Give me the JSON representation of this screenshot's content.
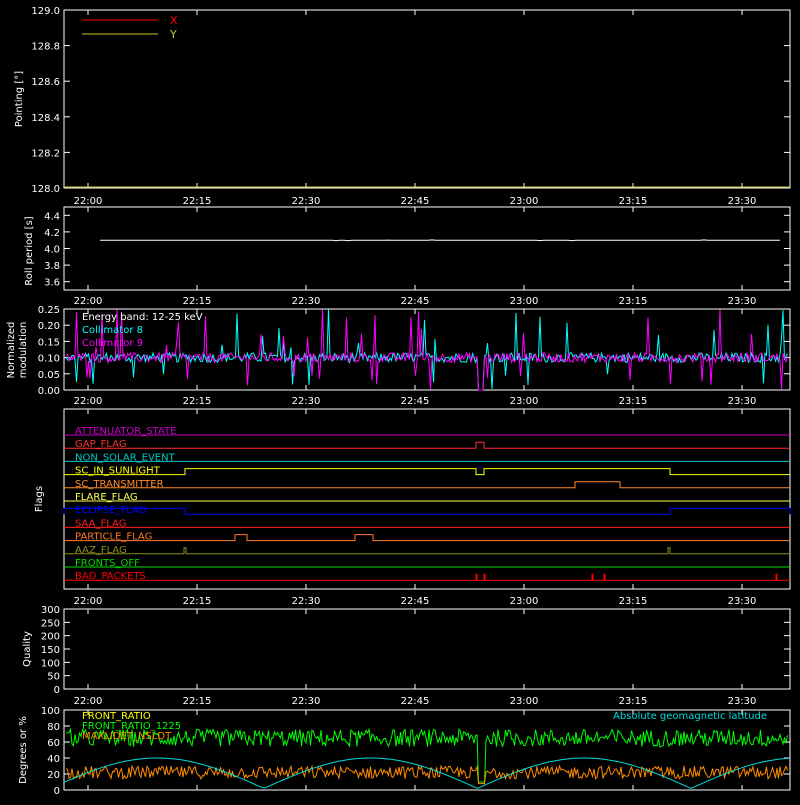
{
  "chart_data": [
    {
      "type": "line",
      "ylabel": "Pointing [°]",
      "ylim": [
        128.0,
        129.0
      ],
      "yticks": [
        "128.0",
        "128.2",
        "128.4",
        "128.6",
        "128.8",
        "129.0"
      ],
      "xticks": [
        "22:00",
        "22:15",
        "22:30",
        "22:45",
        "23:00",
        "23:15",
        "23:30"
      ],
      "legend": [
        {
          "name": "X",
          "color": "#ff0000"
        },
        {
          "name": "Y",
          "color": "#c8c832"
        }
      ],
      "legend_position": "top-left"
    },
    {
      "type": "line",
      "ylabel": "Roll period [s]",
      "ylim": [
        3.5,
        4.5
      ],
      "yticks": [
        "3.6",
        "3.8",
        "4.0",
        "4.2",
        "4.4"
      ],
      "xticks": [
        "22:00",
        "22:15",
        "22:30",
        "22:45",
        "23:00",
        "23:15",
        "23:30"
      ],
      "series": [
        {
          "color": "#ffffff",
          "value": 4.1
        }
      ]
    },
    {
      "type": "line",
      "ylabel_lines": [
        "Normalized",
        "modulation"
      ],
      "ylim": [
        0,
        0.25
      ],
      "yticks": [
        "0.00",
        "0.05",
        "0.10",
        "0.15",
        "0.20",
        "0.25"
      ],
      "xticks": [
        "22:00",
        "22:15",
        "22:30",
        "22:45",
        "23:00",
        "23:15",
        "23:30"
      ],
      "annotation": "Energy band: 12-25 keV",
      "series": [
        {
          "name": "Collimator 8",
          "color": "#00ffff",
          "baseline": 0.1
        },
        {
          "name": "Collimator 9",
          "color": "#ff00ff",
          "baseline": 0.1
        }
      ]
    },
    {
      "type": "table",
      "ylabel": "Flags",
      "xticks": [
        "22:00",
        "22:15",
        "22:30",
        "22:45",
        "23:00",
        "23:15",
        "23:30"
      ],
      "flags": [
        {
          "name": "ATTENUATOR_STATE",
          "color": "#c800c8"
        },
        {
          "name": "GAP_FLAG",
          "color": "#ff3030"
        },
        {
          "name": "NON_SOLAR_EVENT",
          "color": "#00c8c8"
        },
        {
          "name": "SC_IN_SUNLIGHT",
          "color": "#ffff00"
        },
        {
          "name": "SC_TRANSMITTER",
          "color": "#ff8c28"
        },
        {
          "name": "FLARE_FLAG",
          "color": "#ffff50"
        },
        {
          "name": "ECLIPSE_FLAG",
          "color": "#0000ff"
        },
        {
          "name": "SAA_FLAG",
          "color": "#ff1e1e"
        },
        {
          "name": "PARTICLE_FLAG",
          "color": "#ff7828"
        },
        {
          "name": "AAZ_FLAG",
          "color": "#8c8c1e"
        },
        {
          "name": "FRONTS_OFF",
          "color": "#00dc00"
        },
        {
          "name": "BAD_PACKETS",
          "color": "#ff0000"
        }
      ]
    },
    {
      "type": "line",
      "ylabel": "Quality",
      "ylim": [
        0,
        300
      ],
      "yticks": [
        "0",
        "50",
        "100",
        "150",
        "200",
        "250",
        "300"
      ],
      "xticks": [
        "22:00",
        "22:15",
        "22:30",
        "22:45",
        "23:00",
        "23:15",
        "23:30"
      ]
    },
    {
      "type": "line",
      "ylabel": "Degrees or %",
      "ylim": [
        0,
        100
      ],
      "yticks": [
        "0",
        "20",
        "40",
        "60",
        "80",
        "100"
      ],
      "series": [
        {
          "name": "FRONT_RATIO",
          "color": "#ffff00"
        },
        {
          "name": "FRONT_RATIO_1225",
          "color": "#00ff00"
        },
        {
          "name": "MAXLIDET_NSLDT",
          "color": "#ff8c00"
        }
      ],
      "right_label": {
        "text": "Absolute geomagnetic latitude",
        "color": "#00dcdc"
      }
    }
  ]
}
